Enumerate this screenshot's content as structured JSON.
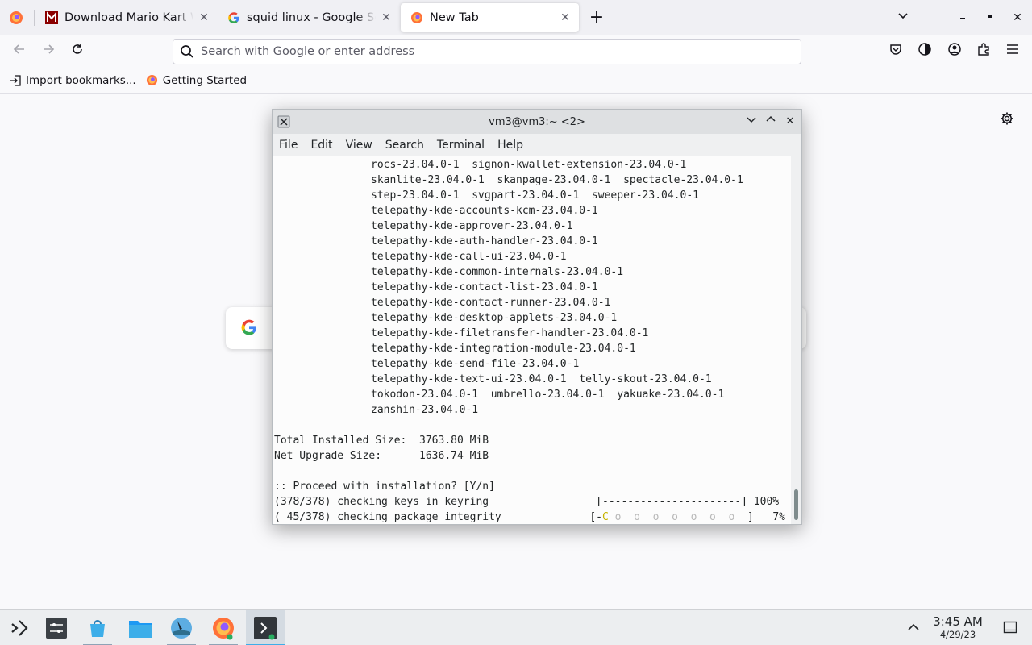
{
  "browser": {
    "tabs": [
      {
        "title": "Download Mario Kart Wii",
        "icon": "mario-kart-favicon",
        "active": false
      },
      {
        "title": "squid linux - Google Search",
        "icon": "google-favicon",
        "active": false
      },
      {
        "title": "New Tab",
        "icon": "firefox-favicon",
        "active": true
      }
    ],
    "urlbar": {
      "placeholder": "Search with Google or enter address",
      "value": ""
    },
    "bookmarks": [
      {
        "label": "Import bookmarks...",
        "icon": "import-icon"
      },
      {
        "label": "Getting Started",
        "icon": "firefox-favicon"
      }
    ],
    "toolbar_icons": [
      "pocket-icon",
      "firefox-view-icon",
      "account-icon",
      "extensions-icon",
      "menu-icon"
    ],
    "accent": "#0061e0"
  },
  "konsole": {
    "title": "vm3@vm3:~ <2>",
    "menu": [
      "File",
      "Edit",
      "View",
      "Search",
      "Terminal",
      "Help"
    ],
    "lines": [
      {
        "text": "rocs-23.04.0-1  signon-kwallet-extension-23.04.0-1",
        "indent": true
      },
      {
        "text": "skanlite-23.04.0-1  skanpage-23.04.0-1  spectacle-23.04.0-1",
        "indent": true
      },
      {
        "text": "step-23.04.0-1  svgpart-23.04.0-1  sweeper-23.04.0-1",
        "indent": true
      },
      {
        "text": "telepathy-kde-accounts-kcm-23.04.0-1",
        "indent": true
      },
      {
        "text": "telepathy-kde-approver-23.04.0-1",
        "indent": true
      },
      {
        "text": "telepathy-kde-auth-handler-23.04.0-1",
        "indent": true
      },
      {
        "text": "telepathy-kde-call-ui-23.04.0-1",
        "indent": true
      },
      {
        "text": "telepathy-kde-common-internals-23.04.0-1",
        "indent": true
      },
      {
        "text": "telepathy-kde-contact-list-23.04.0-1",
        "indent": true
      },
      {
        "text": "telepathy-kde-contact-runner-23.04.0-1",
        "indent": true
      },
      {
        "text": "telepathy-kde-desktop-applets-23.04.0-1",
        "indent": true
      },
      {
        "text": "telepathy-kde-filetransfer-handler-23.04.0-1",
        "indent": true
      },
      {
        "text": "telepathy-kde-integration-module-23.04.0-1",
        "indent": true
      },
      {
        "text": "telepathy-kde-send-file-23.04.0-1",
        "indent": true
      },
      {
        "text": "telepathy-kde-text-ui-23.04.0-1  telly-skout-23.04.0-1",
        "indent": true
      },
      {
        "text": "tokodon-23.04.0-1  umbrello-23.04.0-1  yakuake-23.04.0-1",
        "indent": true
      },
      {
        "text": "zanshin-23.04.0-1",
        "indent": true
      },
      {
        "text": "",
        "indent": false
      },
      {
        "text": "Total Installed Size:  3763.80 MiB",
        "indent": false
      },
      {
        "text": "Net Upgrade Size:      1636.74 MiB",
        "indent": false
      },
      {
        "text": "",
        "indent": false
      },
      {
        "text": ":: Proceed with installation? [Y/n]",
        "indent": false
      },
      {
        "text": "(378/378) checking keys in keyring                 [----------------------] 100%",
        "indent": false
      }
    ],
    "progress_line": {
      "prefix": "( 45/378) checking package integrity              [-",
      "pac": "C",
      "dots": " o  o  o  o  o  o  o ",
      "suffix": " ]   7%",
      "percent": 7
    }
  },
  "taskbar": {
    "items": [
      "application-launcher-icon",
      "system-settings-icon",
      "discover-icon",
      "dolphin-icon",
      "kinfocenter-icon",
      "firefox-icon",
      "konsole-icon"
    ],
    "time": "3:45 AM",
    "date": "4/29/23"
  }
}
